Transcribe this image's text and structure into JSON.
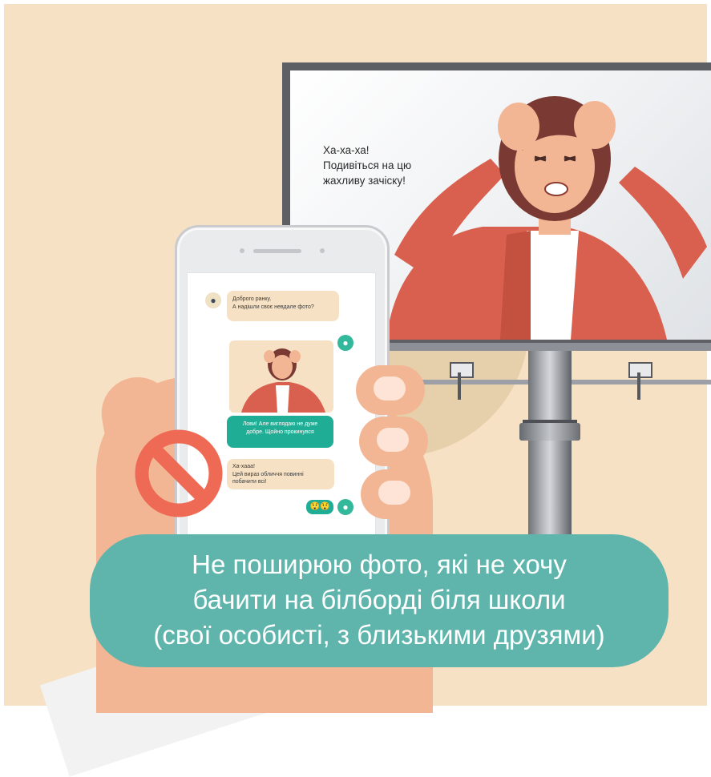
{
  "billboard": {
    "line1": "Ха-ха-ха!",
    "line2": "Подивіться на цю",
    "line3": "жахливу зачіску!"
  },
  "chat": {
    "msg1_line1": "Доброго ранку.",
    "msg1_line2": "А надішли своє невдале фото?",
    "msg2_line1": "Лови! Але виглядаю не дуже",
    "msg2_line2": "добре. Щойно прокинувся",
    "msg3_line1": "Ха-хааа!",
    "msg3_line2": "Цей вираз обличчя повинні",
    "msg3_line3": "побачити всі!",
    "reaction": "😲😲",
    "person_icon": "person-icon"
  },
  "icons": {
    "prohibition": "prohibition-icon",
    "person": "person-icon"
  },
  "caption": {
    "line1": "Не поширюю фото, які не хочу",
    "line2": "бачити на білборді біля школи",
    "line3": "(свої особисті, з близькими друзями)"
  },
  "colors": {
    "background": "#f7e1c4",
    "teal": "#5fb5ac",
    "chat_teal": "#1fae95",
    "stop_red": "#ef6a55",
    "jacket": "#d9604e",
    "hair": "#7a3a33",
    "skin": "#f3b694"
  }
}
